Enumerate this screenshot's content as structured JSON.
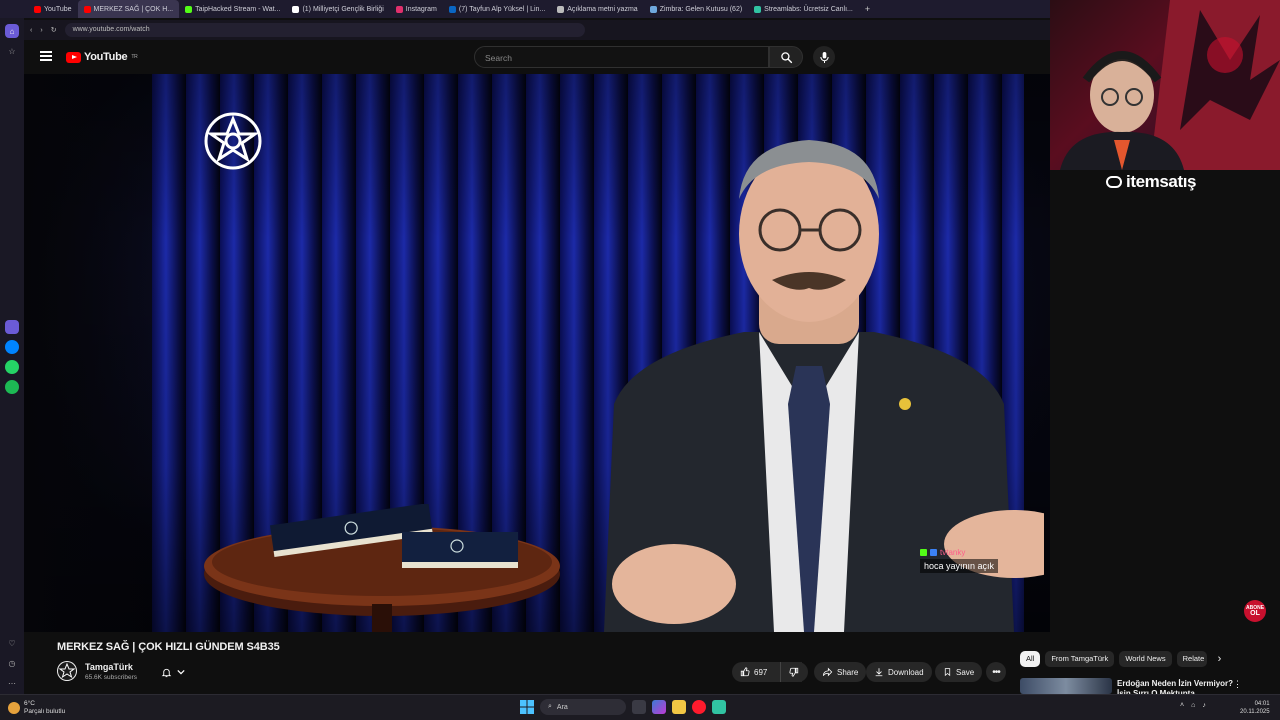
{
  "browser": {
    "tabs": [
      {
        "label": "YouTube",
        "color": "#ff0000"
      },
      {
        "label": "MERKEZ SAĞ | ÇOK H...",
        "color": "#ff0000",
        "active": true
      },
      {
        "label": "TaipHacked Stream - Wat...",
        "color": "#53fc18"
      },
      {
        "label": "(1) Milliyetçi Gençlik Birliği",
        "color": "#ffffff"
      },
      {
        "label": "Instagram",
        "color": "#e1306c"
      },
      {
        "label": "(7) Tayfun Alp Yüksel | Lin...",
        "color": "#0a66c2"
      },
      {
        "label": "Açıklama metni yazma",
        "color": "#bbbbbb"
      },
      {
        "label": "Zimbra: Gelen Kutusu (62)",
        "color": "#6fa8dc"
      },
      {
        "label": "Streamlabs: Ücretsiz Canlı...",
        "color": "#31c3a2"
      }
    ],
    "new_tab": "+",
    "url": "www.youtube.com/watch"
  },
  "youtube": {
    "logo_text": "YouTube",
    "logo_region": "TR",
    "search_placeholder": "Search"
  },
  "overlay": {
    "chat_user": "tvtanky",
    "chat_message": "hoca yayının açık",
    "sponsor": "itemsatış",
    "subscribe_line1": "ABONE",
    "subscribe_line2": "OL"
  },
  "video": {
    "title": "MERKEZ SAĞ | ÇOK HIZLI GÜNDEM S4B35",
    "channel": "TamgaTürk",
    "subscribers": "65.6K subscribers",
    "likes": "697",
    "share": "Share",
    "download": "Download",
    "save": "Save"
  },
  "sidebar_chips": [
    "All",
    "From TamgaTürk",
    "World News",
    "Relate"
  ],
  "recommendation": {
    "title": "Erdoğan Neden İzin Vermiyor? İşin Sırrı O Mektupta"
  },
  "taskbar": {
    "temp": "6°C",
    "weather": "Parçalı bulutlu",
    "search": "Ara",
    "time": "04:01",
    "date": "20.11.2025"
  },
  "colors": {
    "youtube_red": "#ff0000",
    "chat_user": "#ff5c8a",
    "kick_green": "#53fc18"
  }
}
